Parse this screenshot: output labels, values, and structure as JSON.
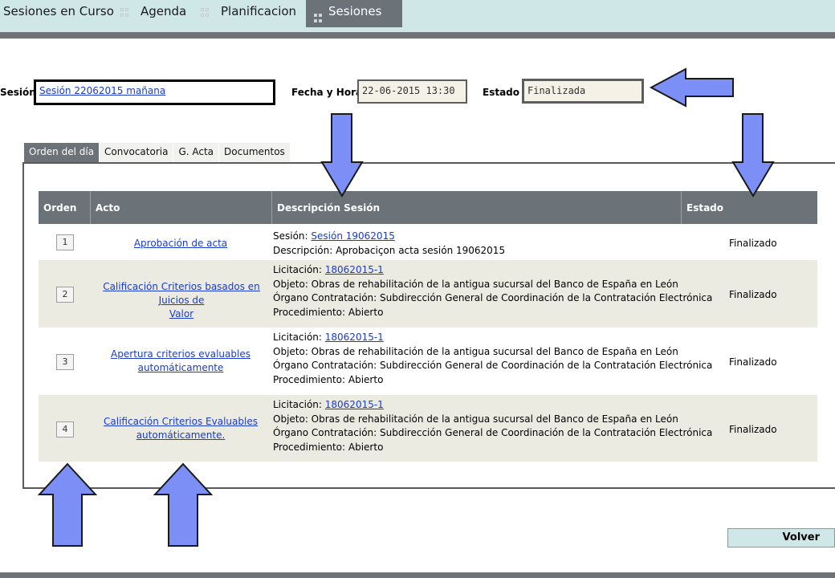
{
  "nav": {
    "items": [
      {
        "label": "Sesiones en Curso",
        "active": false
      },
      {
        "label": "Agenda",
        "active": false
      },
      {
        "label": "Planificacion",
        "active": false
      },
      {
        "label": "Sesiones",
        "active": true
      }
    ]
  },
  "form": {
    "sesion_label": "Sesión",
    "sesion_value": "Sesión 22062015 mañana",
    "fecha_label": "Fecha y Hora",
    "fecha_value": "22-06-2015 13:30",
    "estado_label": "Estado",
    "estado_value": "Finalizada"
  },
  "tabs": [
    {
      "label": "Orden del día",
      "active": true
    },
    {
      "label": "Convocatoria",
      "active": false
    },
    {
      "label": "G. Acta",
      "active": false
    },
    {
      "label": "Documentos",
      "active": false
    }
  ],
  "table": {
    "headers": {
      "orden": "Orden",
      "acto": "Acto",
      "descripcion": "Descripción Sesión",
      "estado": "Estado"
    },
    "rows": [
      {
        "orden": "1",
        "acto": "Aprobación de acta",
        "desc": {
          "line1_label": "Sesión:",
          "line1_link": "Sesión 19062015",
          "line2": "Descripción: Aprobaciçon acta sesión 19062015"
        },
        "estado": "Finalizado"
      },
      {
        "orden": "2",
        "acto_l1": "Calificación Criterios basados en Juicios de",
        "acto_l2": "Valor",
        "desc": {
          "line1_label": "Licitación:",
          "line1_link": "18062015-1",
          "line2": "Objeto: Obras de rehabilitación de la antigua sucursal del Banco de España en León",
          "line3": "Órgano Contratación: Subdirección General de Coordinación de la Contratación Electrónica",
          "line4": "Procedimiento: Abierto"
        },
        "estado": "Finalizado"
      },
      {
        "orden": "3",
        "acto_l1": "Apertura criterios evaluables",
        "acto_l2": "automáticamente",
        "desc": {
          "line1_label": "Licitación:",
          "line1_link": "18062015-1",
          "line2": "Objeto: Obras de rehabilitación de la antigua sucursal del Banco de España en León",
          "line3": "Órgano Contratación: Subdirección General de Coordinación de la Contratación Electrónica",
          "line4": "Procedimiento: Abierto"
        },
        "estado": "Finalizado"
      },
      {
        "orden": "4",
        "acto_l1": "Calificación Criterios Evaluables",
        "acto_l2": "automáticamente.",
        "desc": {
          "line1_label": "Licitación:",
          "line1_link": "18062015-1",
          "line2": "Objeto: Obras de rehabilitación de la antigua sucursal del Banco de España en León",
          "line3": "Órgano Contratación: Subdirección General de Coordinación de la Contratación Electrónica",
          "line4": "Procedimiento: Abierto"
        },
        "estado": "Finalizado"
      }
    ]
  },
  "buttons": {
    "volver": "Volver"
  },
  "colors": {
    "arrow_fill": "#7b8ff7",
    "arrow_stroke": "#1a1a1a",
    "header_bg": "#6b7378",
    "nav_bg": "#cfe8e7",
    "link": "#1a3cc7"
  }
}
